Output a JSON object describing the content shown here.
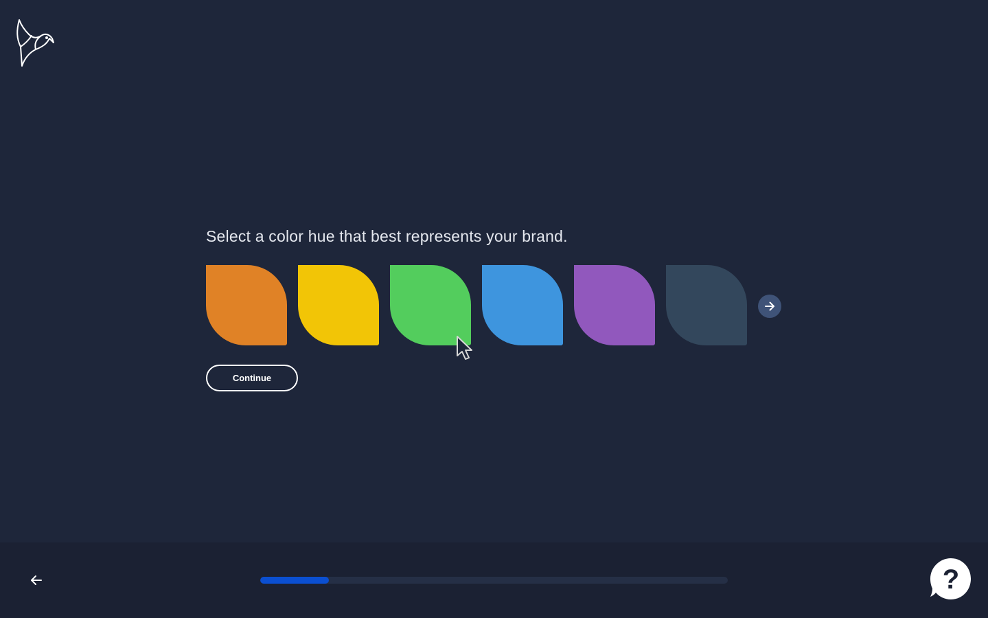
{
  "logo": {
    "icon": "bird-logo-icon"
  },
  "prompt": "Select a color hue that best represents your brand.",
  "swatches": [
    {
      "name": "orange",
      "color": "#e08226"
    },
    {
      "name": "yellow",
      "color": "#f2c506"
    },
    {
      "name": "green",
      "color": "#53cd5d"
    },
    {
      "name": "blue",
      "color": "#3e95de"
    },
    {
      "name": "purple",
      "color": "#9158bd"
    },
    {
      "name": "slate",
      "color": "#33475c"
    }
  ],
  "continue_label": "Continue",
  "footer": {
    "back_icon": "arrow-left-icon",
    "progress": 0.147,
    "help_icon": "question-bubble-icon"
  },
  "colors": {
    "background": "#1e263a",
    "footer_bg": "#1b2133",
    "progress_fill": "#0b4fd1",
    "progress_track": "#252f46",
    "next_arrow_bg": "#3f5378"
  }
}
